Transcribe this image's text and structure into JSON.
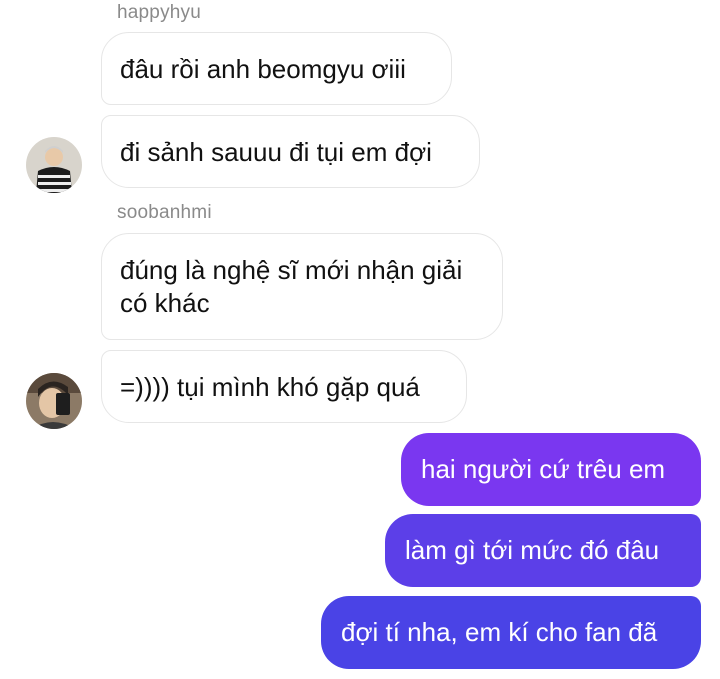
{
  "conversation": {
    "incoming": [
      {
        "sender": "happyhyu",
        "messages": [
          "đâu rồi anh beomgyu ơiii",
          "đi sảnh sauuu đi tụi em đợi"
        ]
      },
      {
        "sender": "soobanhmi",
        "messages": [
          "đúng là nghệ sĩ mới nhận giải có khác",
          "=)))) tụi mình khó gặp quá"
        ]
      }
    ],
    "outgoing": [
      "hai người cứ trêu em",
      "làm gì tới mức đó đâu",
      "đợi tí nha, em kí cho fan đã"
    ]
  },
  "colors": {
    "outgoing_top": "#7a37f0",
    "outgoing_mid": "#5c3fe8",
    "outgoing_bottom": "#4a43e6",
    "incoming_border": "#e6e6e6"
  },
  "icons": [
    "avatar-happyhyu",
    "avatar-soobanhmi"
  ]
}
